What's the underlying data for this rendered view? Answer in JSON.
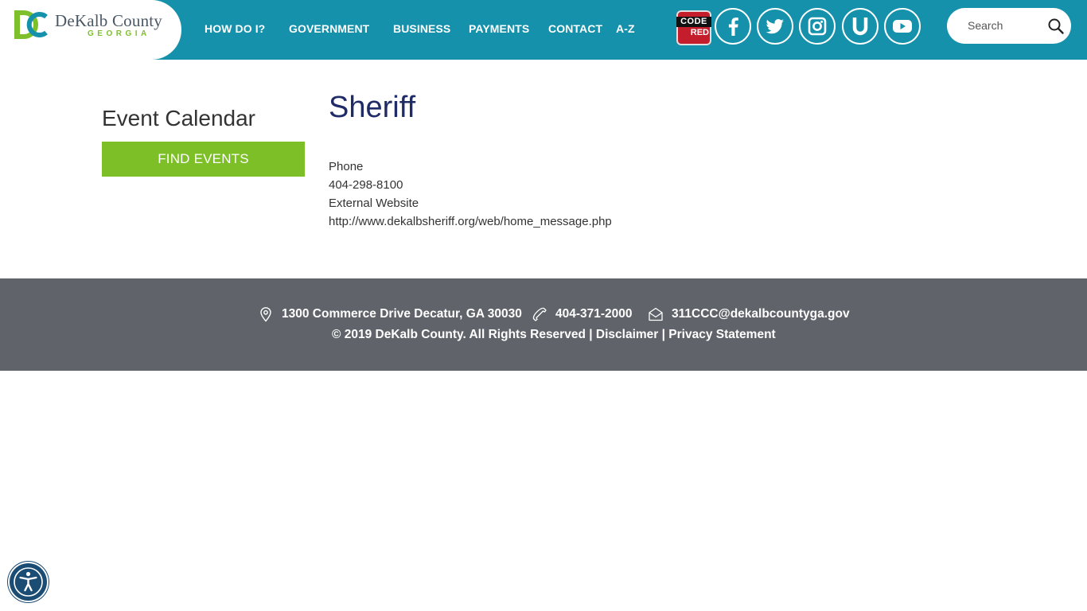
{
  "header": {
    "logo": {
      "county": "DeKalb County",
      "state": "GEORGIA",
      "monogram": "DC"
    },
    "nav": [
      {
        "label": "HOW DO I?"
      },
      {
        "label": "GOVERNMENT"
      },
      {
        "label": "BUSINESS"
      },
      {
        "label": "PAYMENTS"
      },
      {
        "label": "CONTACT"
      },
      {
        "label": "A-Z"
      }
    ],
    "codered": {
      "top": "CODE",
      "bottom": "RED"
    },
    "social_icons": [
      "facebook-icon",
      "twitter-icon",
      "instagram-icon",
      "u-icon",
      "youtube-icon"
    ],
    "search": {
      "placeholder": "Search",
      "value": ""
    }
  },
  "sidebar": {
    "title": "Event Calendar",
    "find_events_label": "FIND EVENTS"
  },
  "main": {
    "title": "Sheriff",
    "phone_label": "Phone",
    "phone": "404-298-8100",
    "website_label": "External Website",
    "website": "http://www.dekalbsheriff.org/web/home_message.php"
  },
  "footer": {
    "address": "1300 Commerce Drive Decatur, GA 30030",
    "phone": "404-371-2000",
    "email": "311CCC@dekalbcountyga.gov",
    "copyright": "© 2019 DeKalb County. All Rights Reserved",
    "separator": "|",
    "disclaimer": "Disclaimer",
    "privacy": "Privacy Statement"
  },
  "colors": {
    "header_bg": "#1591ab",
    "footer_bg": "#60646a",
    "accent_green": "#7dbf26",
    "title_navy": "#1f2b66",
    "codered": "#c41d2b"
  }
}
